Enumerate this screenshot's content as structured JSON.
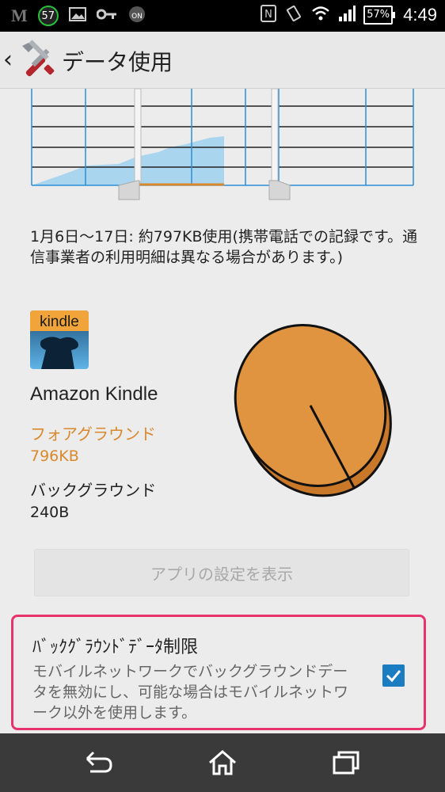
{
  "status_bar": {
    "notification_badge": "57",
    "battery": "57%",
    "time": "4:49"
  },
  "action_bar": {
    "title": "データ使用"
  },
  "usage": {
    "summary": "1月6日～17日: 約797KB使用(携帯電話での記録です。通信事業者の利用明細は異なる場合があります。)"
  },
  "app": {
    "icon_text": "kindle",
    "name": "Amazon Kindle",
    "foreground_label": "フォアグラウンド",
    "foreground_value": "796KB",
    "background_label": "バックグラウンド",
    "background_value": "240B"
  },
  "settings_button": {
    "label": "アプリの設定を表示"
  },
  "restrict_background": {
    "title": "ﾊﾞｯｸｸﾞﾗｳﾝﾄﾞﾃﾞｰﾀ制限",
    "description": "モバイルネットワークでバックグラウンドデータを無効にし、可能な場合はモバイルネットワーク以外を使用します。",
    "checked": true
  },
  "colors": {
    "accent_orange": "#d9892c",
    "chart_fill": "#a9d5ee",
    "chart_grid_blue": "#2d8fd6",
    "highlight_border": "#e8336d",
    "checkbox_blue": "#1a7dc2"
  }
}
